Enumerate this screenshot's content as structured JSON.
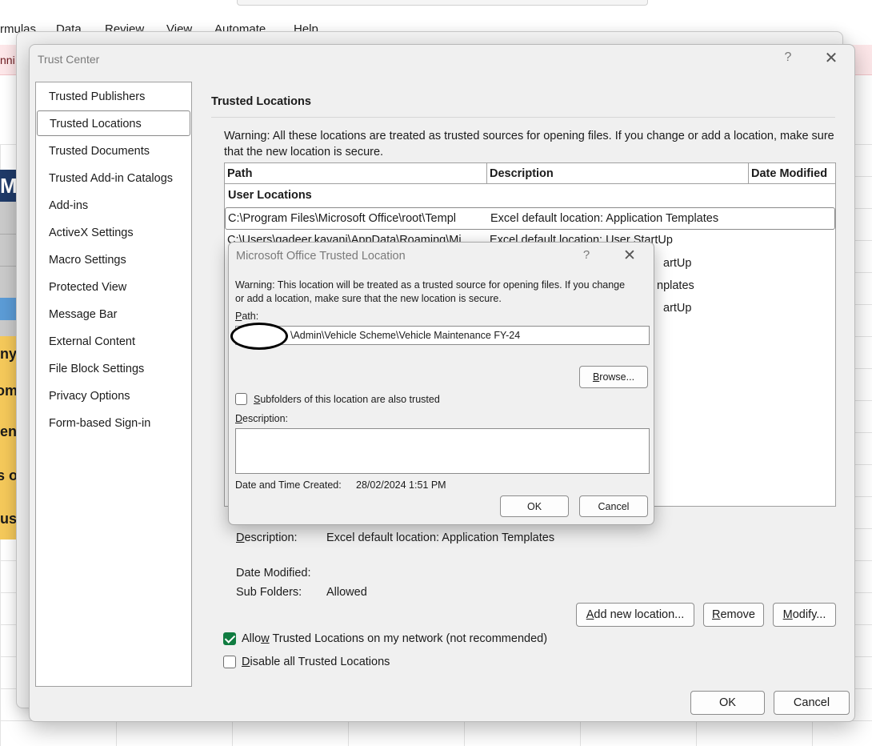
{
  "excel_background": {
    "menu": [
      "rmulas",
      "Data",
      "Review",
      "View",
      "Automate",
      "Help"
    ],
    "banner_fragment": "nni",
    "cell_fragments": [
      "M",
      "ny",
      "om",
      "en",
      "s o",
      "us"
    ]
  },
  "trust_center": {
    "title": "Trust Center",
    "help_glyph": "?",
    "close_glyph": "✕",
    "nav_items": [
      "Trusted Publishers",
      "Trusted Locations",
      "Trusted Documents",
      "Trusted Add-in Catalogs",
      "Add-ins",
      "ActiveX Settings",
      "Macro Settings",
      "Protected View",
      "Message Bar",
      "External Content",
      "File Block Settings",
      "Privacy Options",
      "Form-based Sign-in"
    ],
    "selected_nav": "Trusted Locations",
    "heading": "Trusted Locations",
    "warning": "Warning: All these locations are treated as trusted sources for opening files.  If you change or add a location, make sure that the new location is secure.",
    "table": {
      "columns": [
        "Path",
        "Description",
        "Date Modified"
      ],
      "group_label": "User Locations",
      "rows": [
        {
          "path": "C:\\Program Files\\Microsoft Office\\root\\Templ",
          "description": "Excel default location: Application Templates",
          "selected": true
        },
        {
          "path": "C:\\Users\\qadeer.kavani\\AppData\\Roaming\\Mi",
          "description": "Excel default location: User StartUp",
          "selected": false
        }
      ],
      "partially_hidden": [
        "artUp",
        "nplates",
        "artUp"
      ]
    },
    "details": {
      "description_label": "Description:",
      "description_value": "Excel default location: Application Templates",
      "date_modified_label": "Date Modified:",
      "date_modified_value": "",
      "sub_folders_label": "Sub Folders:",
      "sub_folders_value": "Allowed"
    },
    "buttons": {
      "add_new_location": "Add new location...",
      "remove": "Remove",
      "modify": "Modify...",
      "ok": "OK",
      "cancel": "Cancel"
    },
    "checkboxes": {
      "allow_network": {
        "label": "Allow Trusted Locations on my network (not recommended)",
        "checked": true
      },
      "disable_all": {
        "label": "Disable all Trusted Locations",
        "checked": false
      }
    }
  },
  "trusted_location_dialog": {
    "title": "Microsoft Office Trusted Location",
    "help_glyph": "?",
    "close_glyph": "✕",
    "warning": "Warning: This location will be treated as a trusted source for opening files. If you change or add a location, make sure that the new location is secure.",
    "path_label": "Path:",
    "path_value": "\\Admin\\Vehicle Scheme\\Vehicle Maintenance FY-24",
    "browse_label": "Browse...",
    "subfolders": {
      "label": "Subfolders of this location are also trusted",
      "checked": false
    },
    "description_label": "Description:",
    "description_value": "",
    "date_created_label": "Date and Time Created:",
    "date_created_value": "28/02/2024 1:51 PM",
    "ok_label": "OK",
    "cancel_label": "Cancel"
  },
  "colors": {
    "accent_green": "#107c41",
    "dialog_bg": "#f0f0f0",
    "banner_pink": "#fde7e9"
  }
}
